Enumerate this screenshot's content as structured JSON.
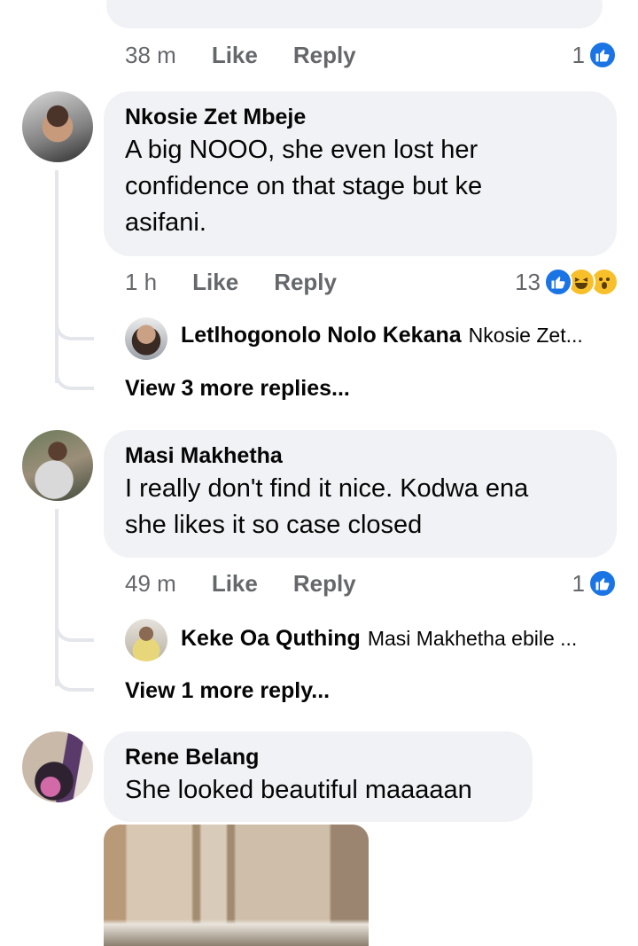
{
  "top_meta": {
    "time": "38 m",
    "like": "Like",
    "reply": "Reply",
    "reactions": "1"
  },
  "comments": [
    {
      "author": "Nkosie Zet Mbeje",
      "text_lines": [
        "A big NOOO, she even lost her",
        "confidence on that stage but ke",
        "asifani."
      ],
      "time": "1 h",
      "like": "Like",
      "reply": "Reply",
      "reactions": "13",
      "reply_preview": {
        "name": "Letlhogonolo Nolo Kekana",
        "text": "Nkosie Zet..."
      },
      "more_replies": "View 3 more replies..."
    },
    {
      "author": "Masi Makhetha",
      "text_lines": [
        "I really don't find it nice. Kodwa ena",
        "she likes it so case closed"
      ],
      "time": "49 m",
      "like": "Like",
      "reply": "Reply",
      "reactions": "1",
      "reply_preview": {
        "name": "Keke Oa Quthing",
        "text": "Masi Makhetha ebile ..."
      },
      "more_replies": "View 1 more reply..."
    },
    {
      "author": "Rene Belang",
      "text_lines": [
        "She looked beautiful maaaaan"
      ]
    }
  ],
  "icons": {
    "like": "thumbs-up-reaction-icon",
    "haha": "laughing-reaction-icon",
    "wow": "wow-reaction-icon"
  },
  "colors": {
    "bubble": "#f0f2f5",
    "meta": "#65676b",
    "like_blue": "#1b74e4",
    "thread": "#e4e6eb"
  }
}
